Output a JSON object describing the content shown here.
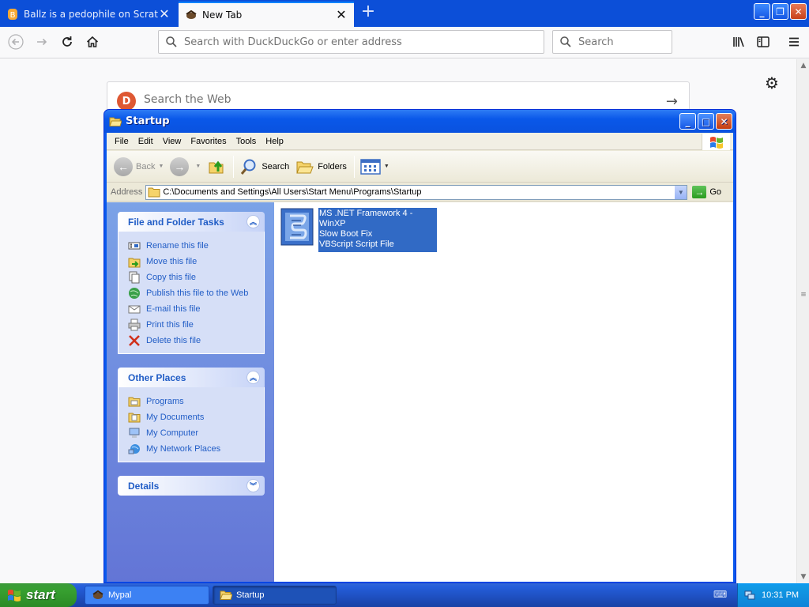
{
  "browser": {
    "tabs": [
      {
        "title": "Ballz is a pedophile on Scratch",
        "active": false
      },
      {
        "title": "New Tab",
        "active": true
      }
    ],
    "urlbar_placeholder": "Search with DuckDuckGo or enter address",
    "searchbar_placeholder": "Search",
    "page": {
      "search_placeholder": "Search the Web"
    }
  },
  "explorer": {
    "title": "Startup",
    "menus": [
      "File",
      "Edit",
      "View",
      "Favorites",
      "Tools",
      "Help"
    ],
    "toolbar": {
      "back": "Back",
      "search": "Search",
      "folders": "Folders"
    },
    "address": {
      "label": "Address",
      "path": "C:\\Documents and Settings\\All Users\\Start Menu\\Programs\\Startup",
      "go": "Go"
    },
    "file_tasks": {
      "title": "File and Folder Tasks",
      "items": [
        {
          "label": "Rename this file",
          "icon": "rename-icon"
        },
        {
          "label": "Move this file",
          "icon": "move-icon"
        },
        {
          "label": "Copy this file",
          "icon": "copy-icon"
        },
        {
          "label": "Publish this file to the Web",
          "icon": "publish-icon"
        },
        {
          "label": "E-mail this file",
          "icon": "email-icon"
        },
        {
          "label": "Print this file",
          "icon": "print-icon"
        },
        {
          "label": "Delete this file",
          "icon": "delete-icon"
        }
      ]
    },
    "other_places": {
      "title": "Other Places",
      "items": [
        {
          "label": "Programs",
          "icon": "folder-icon"
        },
        {
          "label": "My Documents",
          "icon": "my-documents-icon"
        },
        {
          "label": "My Computer",
          "icon": "my-computer-icon"
        },
        {
          "label": "My Network Places",
          "icon": "network-icon"
        }
      ]
    },
    "details": {
      "title": "Details"
    },
    "file": {
      "name_line1": "MS .NET Framework 4 - WinXP",
      "name_line2": "Slow Boot Fix",
      "type": "VBScript Script File"
    }
  },
  "taskbar": {
    "start": "start",
    "buttons": [
      {
        "label": "Mypal",
        "active": false
      },
      {
        "label": "Startup",
        "active": true
      }
    ],
    "clock": "10:31 PM"
  },
  "colors": {
    "xp_blue": "#0a59ed",
    "selection": "#316ac5",
    "task_link": "#215dc6",
    "start_green": "#37a030"
  }
}
